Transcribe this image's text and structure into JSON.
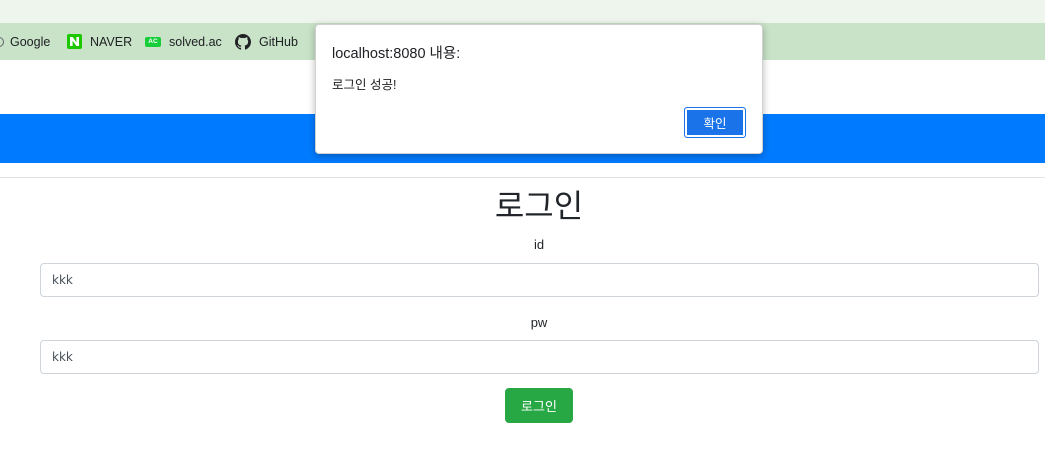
{
  "browser": {
    "bookmarks": [
      {
        "label": "Google",
        "icon": "google-icon"
      },
      {
        "label": "NAVER",
        "icon": "naver-icon"
      },
      {
        "label": "solved.ac",
        "icon": "solved-ac-icon",
        "icon_text": "AC"
      },
      {
        "label": "GitHub",
        "icon": "github-icon"
      }
    ],
    "bookmarks_bar_color": "#c8e3c8"
  },
  "navbar": {
    "color": "#007bff"
  },
  "login": {
    "title": "로그인",
    "id_label": "id",
    "id_value": "kkk",
    "pw_label": "pw",
    "pw_value": "kkk",
    "submit_label": "로그인",
    "submit_color": "#28a745"
  },
  "alert": {
    "title": "localhost:8080 내용:",
    "message": "로그인 성공!",
    "ok_label": "확인",
    "ok_color": "#1a73e8"
  }
}
